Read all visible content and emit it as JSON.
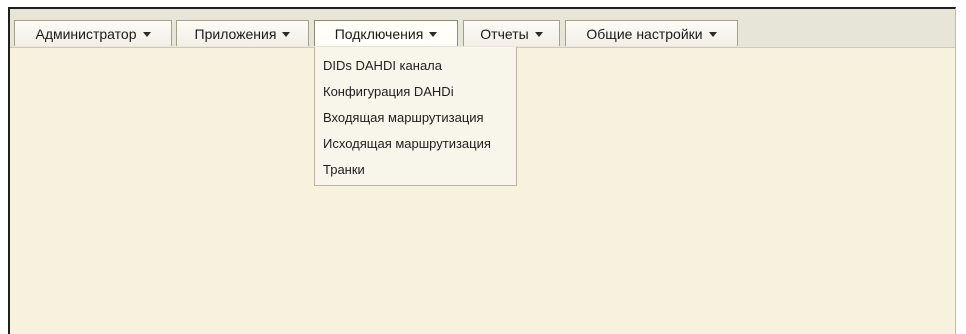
{
  "menubar": {
    "items": [
      {
        "label": "Администратор"
      },
      {
        "label": "Приложения"
      },
      {
        "label": "Подключения"
      },
      {
        "label": "Отчеты"
      },
      {
        "label": "Общие настройки"
      }
    ],
    "active_index": 2
  },
  "dropdown": {
    "items": [
      {
        "label": "DIDs DAHDI канала"
      },
      {
        "label": "Конфигурация DAHDi"
      },
      {
        "label": "Входящая маршрутизация"
      },
      {
        "label": "Исходящая маршрутизация"
      },
      {
        "label": "Транки"
      }
    ]
  },
  "colors": {
    "content_background": "#f6f2dd",
    "menubar_background": "#e7e5d7",
    "dropdown_background": "#f8f5ea"
  },
  "icons": {
    "menu_arrow": "caret-down-icon"
  }
}
